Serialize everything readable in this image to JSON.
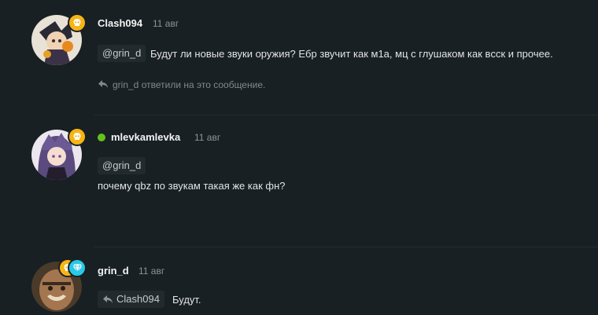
{
  "posts": [
    {
      "username": "Clash094",
      "time": "11 авг",
      "mention": "@grin_d",
      "text": "Будут ли новые звуки оружия? Ебр звучит как м1а, мц с глушаком как вcск и прочее.",
      "reply_note": "grin_d ответили на это сообщение.",
      "badge_icon": "skull-icon"
    },
    {
      "username": "mlevkamlevka",
      "time": "11 авг",
      "mention": "@grin_d",
      "text": "почему qbz по звукам такая же как фн?",
      "online": true,
      "badge_icon": "skull-icon"
    },
    {
      "username": "grin_d",
      "time": "11 авг",
      "reply_to": "Clash094",
      "text": "Будут.",
      "badge_icons": [
        "skull-icon",
        "diamond-icon"
      ]
    }
  ],
  "colors": {
    "background": "#192023",
    "badge_gold": "#f7b514",
    "badge_cyan": "#29c8e8",
    "online": "#64c11c"
  }
}
